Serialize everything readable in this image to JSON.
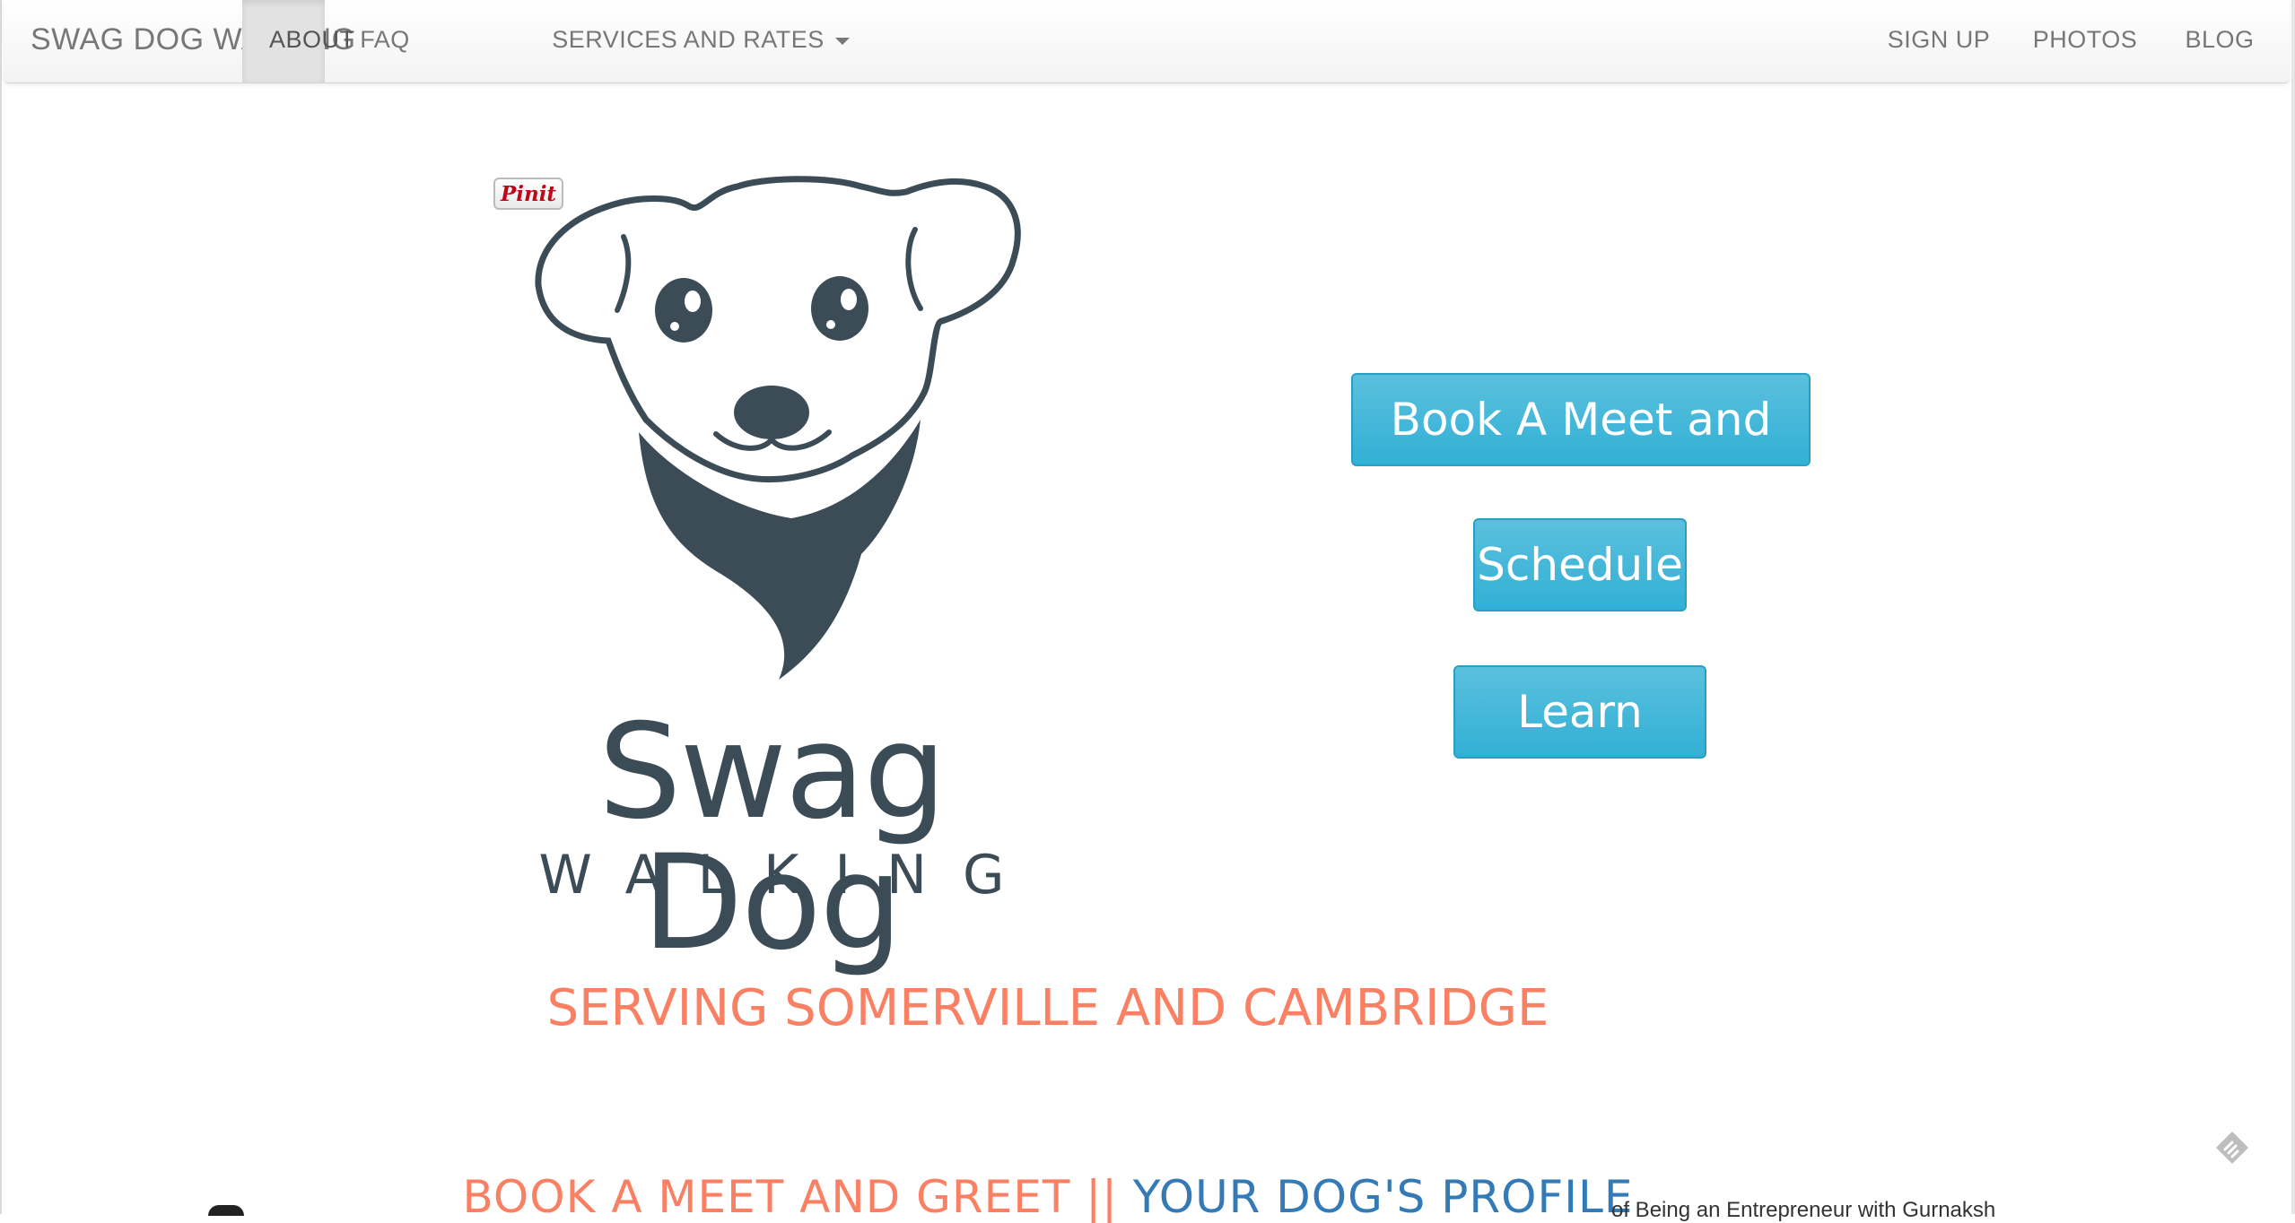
{
  "navbar": {
    "brand": "SWAG DOG WALKING",
    "items": [
      {
        "label": "ABOUT",
        "active": true
      },
      {
        "label": "FAQ"
      },
      {
        "label": "SERVICES AND RATES"
      },
      {
        "label": "SIGN UP"
      },
      {
        "label": "PHOTOS"
      },
      {
        "label": "BLOG"
      }
    ]
  },
  "pinit": "Pinit",
  "logo": {
    "title": "Swag Dog",
    "subtitle": "WALKING"
  },
  "buttons": {
    "meet": "Book A Meet and Greet",
    "schedule": "Schedule",
    "learn": "Learn More"
  },
  "tagline": "SERVING SOMERVILLE AND CAMBRIDGE",
  "bottom_links": {
    "meet": "BOOK A MEET AND GREET",
    "separator": "||",
    "profile": "YOUR DOG'S PROFILE"
  },
  "snippet": "of Being an Entrepreneur with Gurnaksh",
  "colors": {
    "accent_button": "#31b0d5",
    "tagline": "#fa8064",
    "link_blue": "#337ab7",
    "logo": "#3c4c57"
  }
}
